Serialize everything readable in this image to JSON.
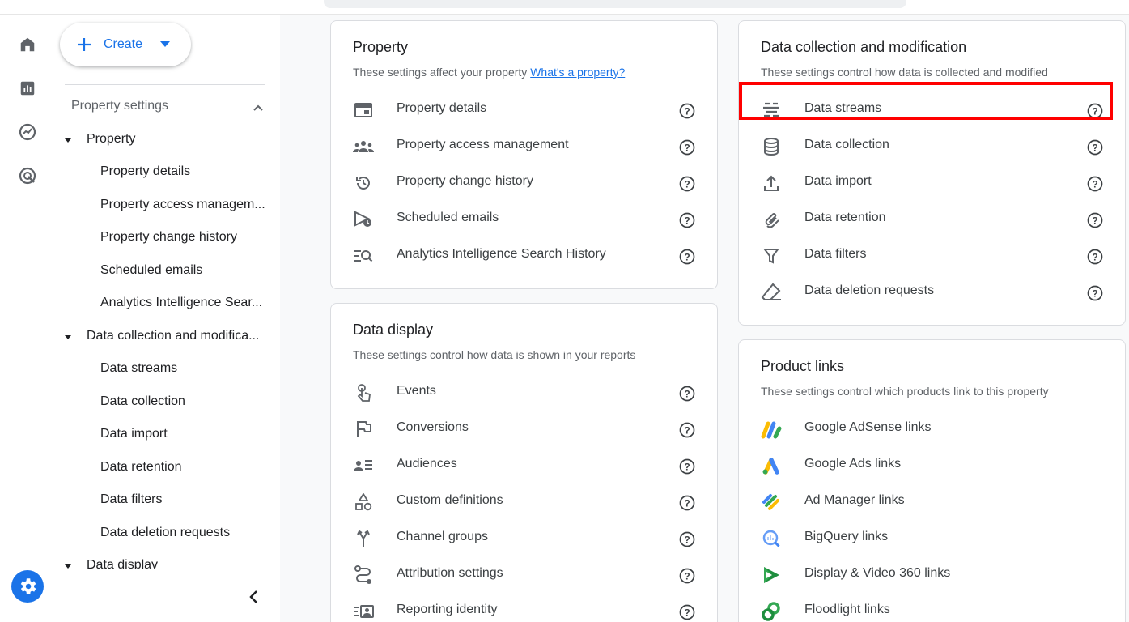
{
  "nav": {
    "create_label": "Create",
    "section_title": "Property settings",
    "groups": [
      {
        "label": "Property",
        "items": [
          "Property details",
          "Property access managem...",
          "Property change history",
          "Scheduled emails",
          "Analytics Intelligence Sear..."
        ]
      },
      {
        "label": "Data collection and modifica...",
        "items": [
          "Data streams",
          "Data collection",
          "Data import",
          "Data retention",
          "Data filters",
          "Data deletion requests"
        ]
      },
      {
        "label": "Data display",
        "items": []
      }
    ]
  },
  "property_card": {
    "title": "Property",
    "subtitle": "These settings affect your property",
    "subtitle_link": "What's a property?",
    "items": [
      {
        "label": "Property details",
        "icon": "property-details-icon"
      },
      {
        "label": "Property access management",
        "icon": "people-icon"
      },
      {
        "label": "Property change history",
        "icon": "history-icon"
      },
      {
        "label": "Scheduled emails",
        "icon": "scheduled-email-icon"
      },
      {
        "label": "Analytics Intelligence Search History",
        "icon": "search-list-icon"
      }
    ]
  },
  "data_display_card": {
    "title": "Data display",
    "subtitle": "These settings control how data is shown in your reports",
    "items": [
      {
        "label": "Events",
        "icon": "touch-icon"
      },
      {
        "label": "Conversions",
        "icon": "flag-icon"
      },
      {
        "label": "Audiences",
        "icon": "audience-icon"
      },
      {
        "label": "Custom definitions",
        "icon": "shapes-icon"
      },
      {
        "label": "Channel groups",
        "icon": "merge-icon"
      },
      {
        "label": "Attribution settings",
        "icon": "route-icon"
      },
      {
        "label": "Reporting identity",
        "icon": "identity-icon"
      }
    ]
  },
  "data_collection_card": {
    "title": "Data collection and modification",
    "subtitle": "These settings control how data is collected and modified",
    "items": [
      {
        "label": "Data streams",
        "icon": "streams-icon"
      },
      {
        "label": "Data collection",
        "icon": "database-icon"
      },
      {
        "label": "Data import",
        "icon": "upload-icon"
      },
      {
        "label": "Data retention",
        "icon": "paperclip-icon"
      },
      {
        "label": "Data filters",
        "icon": "filter-icon"
      },
      {
        "label": "Data deletion requests",
        "icon": "eraser-icon"
      }
    ]
  },
  "product_links_card": {
    "title": "Product links",
    "subtitle": "These settings control which products link to this property",
    "items": [
      {
        "label": "Google AdSense links",
        "icon": "adsense-logo-icon"
      },
      {
        "label": "Google Ads links",
        "icon": "google-ads-logo-icon"
      },
      {
        "label": "Ad Manager links",
        "icon": "ad-manager-logo-icon"
      },
      {
        "label": "BigQuery links",
        "icon": "bigquery-logo-icon"
      },
      {
        "label": "Display & Video 360 links",
        "icon": "dv360-logo-icon"
      },
      {
        "label": "Floodlight links",
        "icon": "floodlight-logo-icon"
      }
    ]
  },
  "colors": {
    "accent": "#1a73e8",
    "highlight": "#ff0000"
  }
}
